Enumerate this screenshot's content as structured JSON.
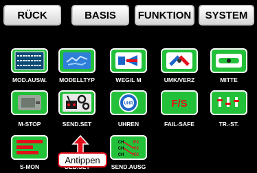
{
  "tabs": [
    "RÜCK",
    "BASIS",
    "FUNKTION",
    "SYSTEM"
  ],
  "menu": [
    {
      "label": "MOD.AUSW.",
      "icon": "model-memory-icon"
    },
    {
      "label": "MODELLTYP",
      "icon": "model-type-icon"
    },
    {
      "label": "WEG/L M",
      "icon": "servo-travel-icon"
    },
    {
      "label": "UMK/VERZ",
      "icon": "servo-reverse-icon"
    },
    {
      "label": "MITTE",
      "icon": "servo-center-icon"
    },
    {
      "label": "M-STOP",
      "icon": "motor-stop-icon"
    },
    {
      "label": "SEND.SET",
      "icon": "transmitter-settings-icon"
    },
    {
      "label": "UHREN",
      "icon": "timers-icon"
    },
    {
      "label": "FAIL-SAFE",
      "icon": "fail-safe-icon"
    },
    {
      "label": "TR.-ST.",
      "icon": "trim-steps-icon"
    },
    {
      "label": "S-MON",
      "icon": "servo-monitor-icon"
    },
    {
      "label": "GEB.SET",
      "icon": "receiver-settings-icon"
    },
    {
      "label": "SEND.AUSG",
      "icon": "transmitter-output-icon"
    }
  ],
  "icon_glyphs": {
    "fail_safe": "F/S",
    "timers": "UHR",
    "out_matrix": [
      "CH",
      "RX",
      "CH",
      "RX",
      "CH",
      "RX"
    ]
  },
  "callout": {
    "text": "Antippen",
    "target": "SEND.SET",
    "color": "#e3101b"
  },
  "colors": {
    "tile": "#23c03a",
    "background": "#000000"
  }
}
